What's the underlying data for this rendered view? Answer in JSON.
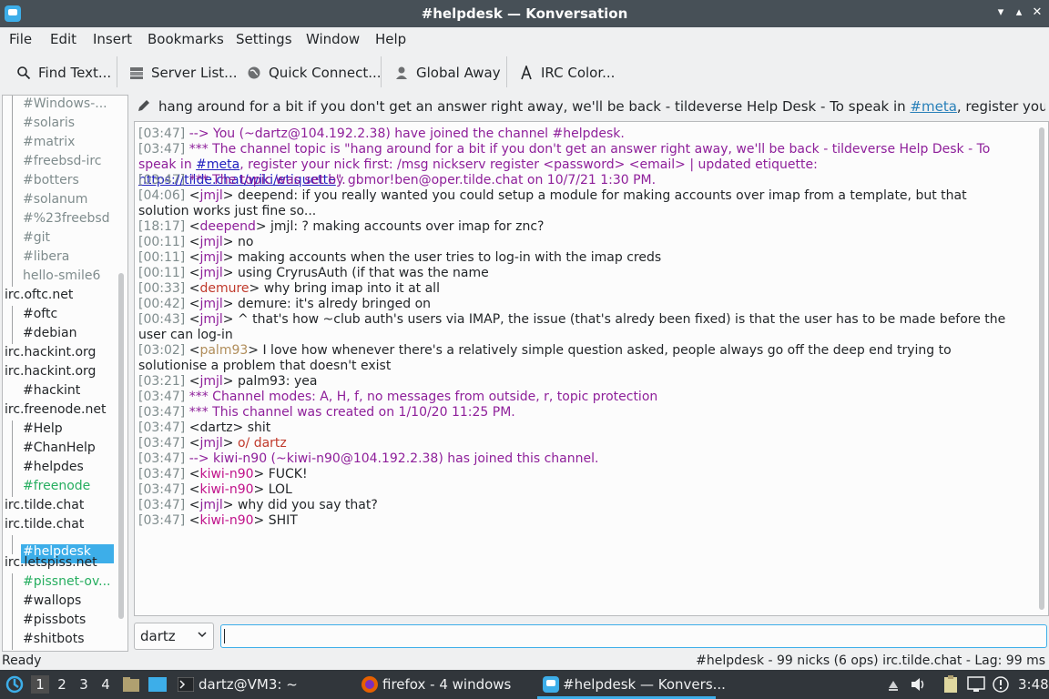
{
  "window": {
    "title": "#helpdesk — Konversation",
    "minimize_glyph": "▾",
    "maximize_glyph": "▴",
    "close_glyph": "✕"
  },
  "menu": [
    "File",
    "Edit",
    "Insert",
    "Bookmarks",
    "Settings",
    "Window",
    "Help"
  ],
  "toolbar": {
    "find_text": "Find Text...",
    "server_list": "Server List...",
    "quick_connect": "Quick Connect...",
    "global_away": "Global Away",
    "irc_color": "IRC Color..."
  },
  "tree": [
    {
      "label": "#Windows-...",
      "kind": "child"
    },
    {
      "label": "#solaris",
      "kind": "child"
    },
    {
      "label": "#matrix",
      "kind": "child"
    },
    {
      "label": "#freebsd-irc",
      "kind": "child"
    },
    {
      "label": "#botters",
      "kind": "child"
    },
    {
      "label": "#solanum",
      "kind": "child"
    },
    {
      "label": "#%23freebsd",
      "kind": "child"
    },
    {
      "label": "#git",
      "kind": "child"
    },
    {
      "label": "#libera",
      "kind": "child"
    },
    {
      "label": "hello-smile6",
      "kind": "child"
    },
    {
      "label": "irc.oftc.net",
      "kind": "net"
    },
    {
      "label": "#oftc",
      "kind": "active"
    },
    {
      "label": "#debian",
      "kind": "active"
    },
    {
      "label": "irc.hackint.org",
      "kind": "net"
    },
    {
      "label": "irc.hackint.org",
      "kind": "net"
    },
    {
      "label": "#hackint",
      "kind": "active"
    },
    {
      "label": "irc.freenode.net",
      "kind": "net"
    },
    {
      "label": "#Help",
      "kind": "active"
    },
    {
      "label": "#ChanHelp",
      "kind": "active"
    },
    {
      "label": "#helpdes",
      "kind": "active"
    },
    {
      "label": "#freenode",
      "kind": "green"
    },
    {
      "label": "irc.tilde.chat",
      "kind": "net"
    },
    {
      "label": "irc.tilde.chat",
      "kind": "net"
    },
    {
      "label": "#helpdesk",
      "kind": "selected"
    },
    {
      "label": "irc.letspiss.net",
      "kind": "net"
    },
    {
      "label": "#pissnet-ov...",
      "kind": "green"
    },
    {
      "label": "#wallops",
      "kind": "active"
    },
    {
      "label": "#pissbots",
      "kind": "active"
    },
    {
      "label": "#shitbots",
      "kind": "active"
    }
  ],
  "topic": {
    "before": "hang around for a bit if you don't get an answer right away, we'll be back - tildeverse Help Desk - To speak in ",
    "link": "#meta",
    "after": ", register your nick first: /..."
  },
  "messages": [
    {
      "ts": "[03:47]",
      "cls": "sys",
      "text": "--> You (~dartz@104.192.2.38) have joined the channel #helpdesk."
    },
    {
      "ts": "[03:47]",
      "cls": "sys",
      "text": "*** The channel topic is \"hang around for a bit if you don't get an answer right away, we'll be back - tildeverse Help Desk - To speak in ",
      "link1": "#meta",
      "mid": ", register your nick first: /msg nickserv register <password> <email> | updated etiquette: ",
      "link2": "https://tilde.chat/wiki/etiquette",
      "end": "\"."
    },
    {
      "ts": "[03:47]",
      "cls": "sys",
      "text": "*** The topic was set by gbmor!ben@oper.tilde.chat on 10/7/21 1:30 PM."
    },
    {
      "ts": "[04:06]",
      "nick": "jmjl",
      "ncls": "jmjl",
      "text": "deepend: if you really wanted you could setup a module for making accounts over imap from a template, but that solution works just fine so..."
    },
    {
      "ts": "[18:17]",
      "nick": "deepend",
      "ncls": "deepend",
      "text": "jmjl: ?  making accounts over imap for znc?"
    },
    {
      "ts": "[00:11]",
      "nick": "jmjl",
      "ncls": "jmjl",
      "text": "no"
    },
    {
      "ts": "[00:11]",
      "nick": "jmjl",
      "ncls": "jmjl",
      "text": "making accounts when the user tries to log-in with the imap creds"
    },
    {
      "ts": "[00:11]",
      "nick": "jmjl",
      "ncls": "jmjl",
      "text": "using CryrusAuth (if that was the name"
    },
    {
      "ts": "[00:33]",
      "nick": "demure",
      "ncls": "demure",
      "text": "why bring imap into it at all"
    },
    {
      "ts": "[00:42]",
      "nick": "jmjl",
      "ncls": "jmjl",
      "text": "demure: it's alredy bringed on"
    },
    {
      "ts": "[00:43]",
      "nick": "jmjl",
      "ncls": "jmjl",
      "text": "^ that's how ~club auth's users via IMAP, the issue (that's alredy been fixed) is that the user has to be made before the user can log-in"
    },
    {
      "ts": "[03:02]",
      "nick": "palm93",
      "ncls": "palm",
      "text": "I love how whenever there's a relatively simple question asked, people always go off the deep end trying to solutionise a problem that doesn't exist"
    },
    {
      "ts": "[03:21]",
      "nick": "jmjl",
      "ncls": "jmjl",
      "text": "palm93: yea"
    },
    {
      "ts": "[03:47]",
      "cls": "sys",
      "text": "*** Channel modes: A, H, f, no messages from outside, r, topic protection"
    },
    {
      "ts": "[03:47]",
      "cls": "sys",
      "text": "*** This channel was created on 1/10/20 11:25 PM."
    },
    {
      "ts": "[03:47]",
      "nick": "dartz",
      "ncls": "plain",
      "text": "shit"
    },
    {
      "ts": "[03:47]",
      "nick": "jmjl",
      "ncls": "jmjl",
      "text": "o/ dartz",
      "tcls": "demure"
    },
    {
      "ts": "[03:47]",
      "cls": "sys",
      "text": "--> kiwi-n90 (~kiwi-n90@104.192.2.38) has joined this channel."
    },
    {
      "ts": "[03:47]",
      "nick": "kiwi-n90",
      "ncls": "kiwi",
      "text": "FUCK!"
    },
    {
      "ts": "[03:47]",
      "nick": "kiwi-n90",
      "ncls": "kiwi",
      "text": "LOL"
    },
    {
      "ts": "[03:47]",
      "nick": "jmjl",
      "ncls": "jmjl",
      "text": "why did you say that?"
    },
    {
      "ts": "[03:47]",
      "nick": "kiwi-n90",
      "ncls": "kiwi",
      "text": "SHIT"
    }
  ],
  "nick_selector": "dartz",
  "status": {
    "left": "Ready",
    "right": "#helpdesk - 99 nicks (6 ops)  irc.tilde.chat - Lag: 99 ms"
  },
  "taskbar": {
    "workspaces": [
      "1",
      "2",
      "3",
      "4"
    ],
    "terminal": "dartz@VM3: ~",
    "firefox": "firefox - 4 windows",
    "konversation": "#helpdesk — Konvers...",
    "clock": "3:48"
  },
  "colors": {
    "accent": "#3daee9",
    "system_message": "#8e1f9a",
    "timestamp": "#7f8c8d"
  }
}
